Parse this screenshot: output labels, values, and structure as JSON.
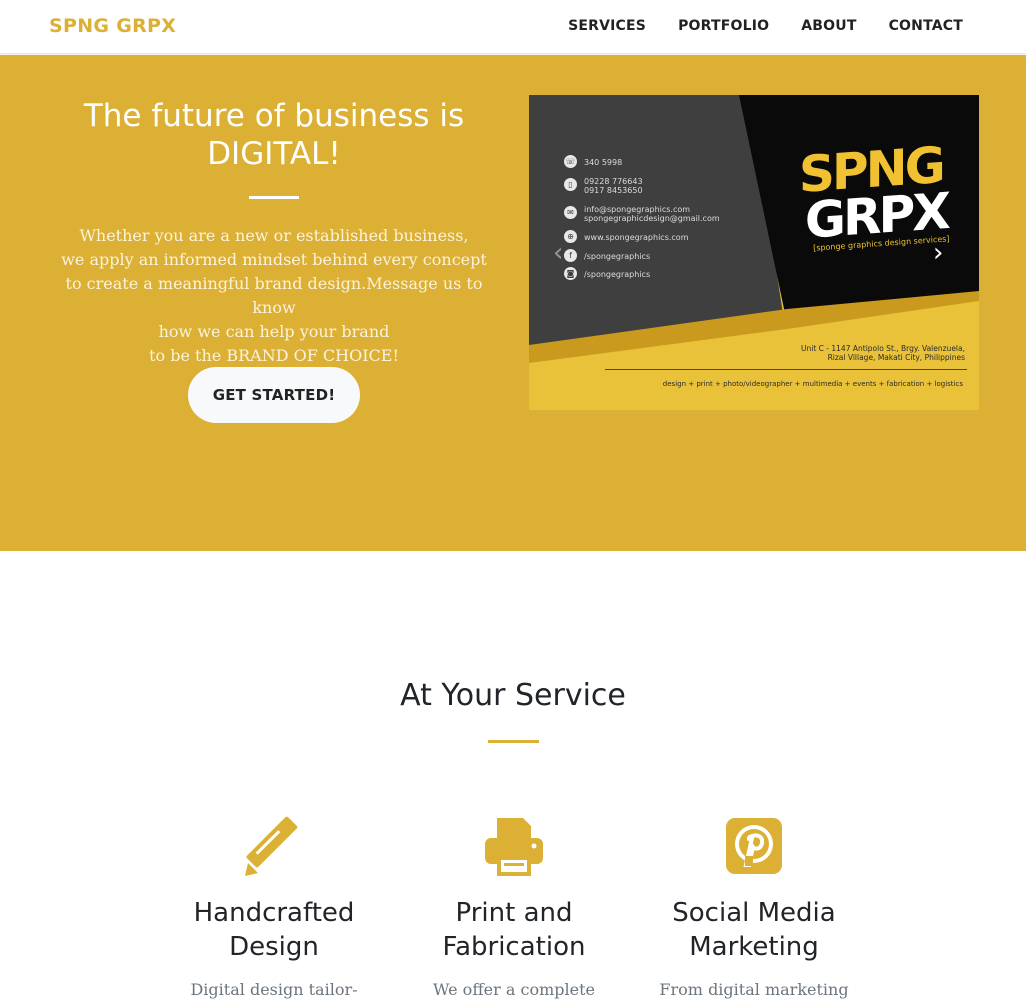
{
  "navbar": {
    "brand": "SPNG GRPX",
    "links": [
      "SERVICES",
      "PORTFOLIO",
      "ABOUT",
      "CONTACT"
    ]
  },
  "hero": {
    "title_lines": [
      "The future of business is",
      "DIGITAL!"
    ],
    "text_lines": [
      "Whether you are a new or established business,",
      "we apply an informed mindset behind every concept",
      "to create a meaningful brand design.Message us to know",
      "how we can help your brand",
      "to be the BRAND OF CHOICE!"
    ],
    "cta_label": "GET STARTED!"
  },
  "carousel": {
    "contacts": [
      {
        "icon": "phone-icon",
        "glyph": "☏",
        "lines": [
          "340 5998"
        ]
      },
      {
        "icon": "mobile-icon",
        "glyph": "▯",
        "lines": [
          "09228 776643",
          "0917 8453650"
        ]
      },
      {
        "icon": "mail-icon",
        "glyph": "✉",
        "lines": [
          "info@spongegraphics.com",
          "spongegraphicdesign@gmail.com"
        ]
      },
      {
        "icon": "globe-icon",
        "glyph": "⊕",
        "lines": [
          "www.spongegraphics.com"
        ]
      },
      {
        "icon": "facebook-icon",
        "glyph": "f",
        "lines": [
          "/spongegraphics"
        ]
      },
      {
        "icon": "instagram-icon",
        "glyph": "◙",
        "lines": [
          "/spongegraphics"
        ]
      }
    ],
    "logo_line1": "SPNG",
    "logo_line2": "GRPX",
    "logo_tagline": "[sponge graphics design services]",
    "address_lines": [
      "Unit C - 1147 Antipolo St., Brgy. Valenzuela,",
      "Rizal Village, Makati City, Philippines"
    ],
    "services_tagline": "design + print + photo/videographer + multimedia + events + fabrication + logistics",
    "prev_glyph": "‹",
    "next_glyph": "›"
  },
  "services": {
    "title": "At Your Service",
    "items": [
      {
        "icon": "pencil-icon",
        "title_lines": [
          "Handcrafted",
          "Design"
        ],
        "text": "Digital design tailor-"
      },
      {
        "icon": "printer-icon",
        "title_lines": [
          "Print and",
          "Fabrication"
        ],
        "text": "We offer a complete"
      },
      {
        "icon": "pinterest-icon",
        "title_lines": [
          "Social Media",
          "Marketing"
        ],
        "text": "From digital marketing"
      }
    ]
  },
  "colors": {
    "accent": "#dcb035",
    "card_dark": "#3f3f3f",
    "card_black": "#000000",
    "card_yellow": "#e9c23a"
  }
}
